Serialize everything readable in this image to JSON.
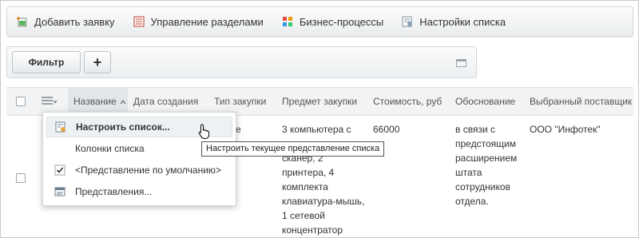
{
  "toolbar": {
    "items": [
      {
        "label": "Добавить заявку",
        "icon": "add-request-icon"
      },
      {
        "label": "Управление разделами",
        "icon": "sections-icon"
      },
      {
        "label": "Бизнес-процессы",
        "icon": "business-process-icon"
      },
      {
        "label": "Настройки списка",
        "icon": "list-settings-icon"
      }
    ]
  },
  "filterbar": {
    "filter_label": "Фильтр",
    "add_label": "+"
  },
  "table": {
    "columns": [
      "Название",
      "Дата создания",
      "Тип закупки",
      "Предмет закупки",
      "Стоимость, руб",
      "Обоснование",
      "Выбранный поставщик"
    ],
    "row": {
      "type_fragment": "е",
      "subject_lines": [
        "3 компьютера с",
        "сканер, 2",
        "принтера, 4",
        "комплекта",
        "клавиатура-мышь,",
        "1 сетевой",
        "концентратор"
      ],
      "cost": "66000",
      "reason_lines": [
        "в связи с",
        "предстоящим",
        "расширением",
        "штата",
        "сотрудников",
        "отдела."
      ],
      "supplier": "ООО \"Инфотек\""
    }
  },
  "popup": {
    "items": [
      {
        "label": "Настроить список...",
        "icon": "settings-list-icon"
      },
      {
        "label": "Колонки списка",
        "icon": ""
      },
      {
        "label": "<Представление по умолчанию>",
        "icon": "checkbox-checked-icon"
      },
      {
        "label": "Представления...",
        "icon": "views-icon"
      }
    ]
  },
  "tooltip": "Настроить текущее представление списка",
  "colors": {
    "accent_red": "#d9342b",
    "accent_green": "#3a9a3a",
    "header_bg": "#f1f3f4"
  }
}
